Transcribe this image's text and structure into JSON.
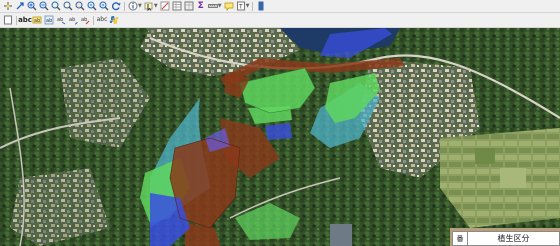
{
  "toolbar_top": {
    "icons": [
      "pan-icon",
      "pan-to-selection-icon",
      "zoom-in-icon",
      "zoom-out-icon",
      "zoom-full-icon",
      "zoom-to-selection-icon",
      "zoom-to-layer-icon",
      "zoom-last-icon",
      "zoom-next-icon",
      "refresh-icon",
      "identify-icon",
      "select-icon",
      "deselect-icon",
      "open-attribute-table-icon",
      "field-calculator-icon",
      "statistics-icon",
      "measure-icon",
      "annotation-icon",
      "map-tips-icon",
      "new-bookmark-icon"
    ]
  },
  "toolbar_bottom": {
    "icons": [
      "label-toolbar-icon",
      "label-text-icon",
      "pin-labels-icon",
      "show-hide-labels-icon",
      "move-label-icon",
      "rotate-label-icon",
      "change-label-icon",
      "label-properties-icon",
      "python-console-icon"
    ]
  },
  "legend": {
    "number_header": "番",
    "title": "植生区分"
  },
  "colors": {
    "toolbar_bg": "#f0f0f0",
    "forest": "#2e4a22",
    "overlay_green": "#5fd65f",
    "overlay_brown": "#8a3a1a",
    "overlay_blue": "#3a4fe0",
    "overlay_cyan": "#4fb3c9",
    "sea": "#1e3a66"
  }
}
